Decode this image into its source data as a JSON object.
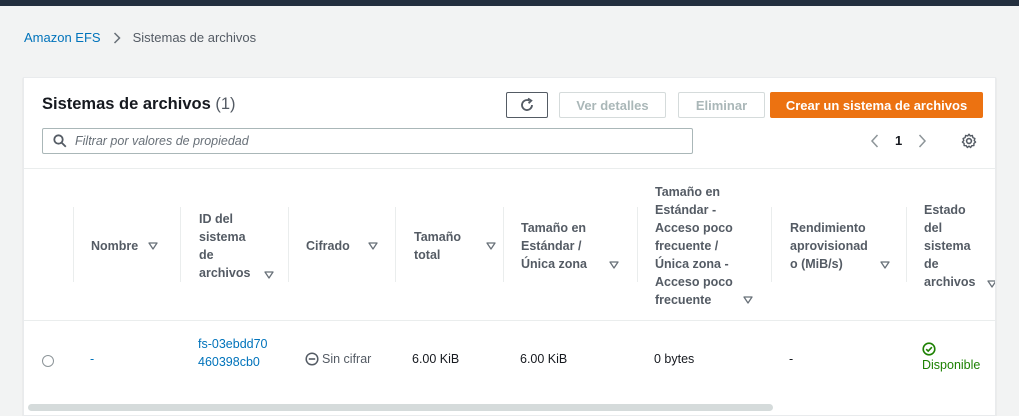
{
  "breadcrumb": {
    "root": "Amazon EFS",
    "current": "Sistemas de archivos"
  },
  "header": {
    "title": "Sistemas de archivos",
    "count": "(1)"
  },
  "toolbar": {
    "details_label": "Ver detalles",
    "delete_label": "Eliminar",
    "create_label": "Crear un sistema de archivos"
  },
  "filter": {
    "placeholder": "Filtrar por valores de propiedad"
  },
  "pagination": {
    "page": "1"
  },
  "columns": [
    "Nombre",
    "ID del\nsistema\nde\narchivos",
    "Cifrado",
    "Tamaño\ntotal",
    "Tamaño en\nEstándar /\nÚnica zona",
    "Tamaño en\nEstándar -\nAcceso poco\nfrecuente /\nÚnica zona -\nAcceso poco\nfrecuente",
    "Rendimiento\naprovisionad\no (MiB/s)",
    "Estado\ndel\nsistema\nde\narchivos"
  ],
  "rows": [
    {
      "name": "-",
      "id": "fs-03ebdd70460398cb0",
      "encryption": "Sin cifrar",
      "total_size": "6.00 KiB",
      "standard_size": "6.00 KiB",
      "ia_size": "0 bytes",
      "throughput": "-",
      "status": "Disponible"
    }
  ],
  "colors": {
    "accent": "#ec7211",
    "link": "#0073bb",
    "success": "#1d8102",
    "topbar": "#232f3e"
  }
}
